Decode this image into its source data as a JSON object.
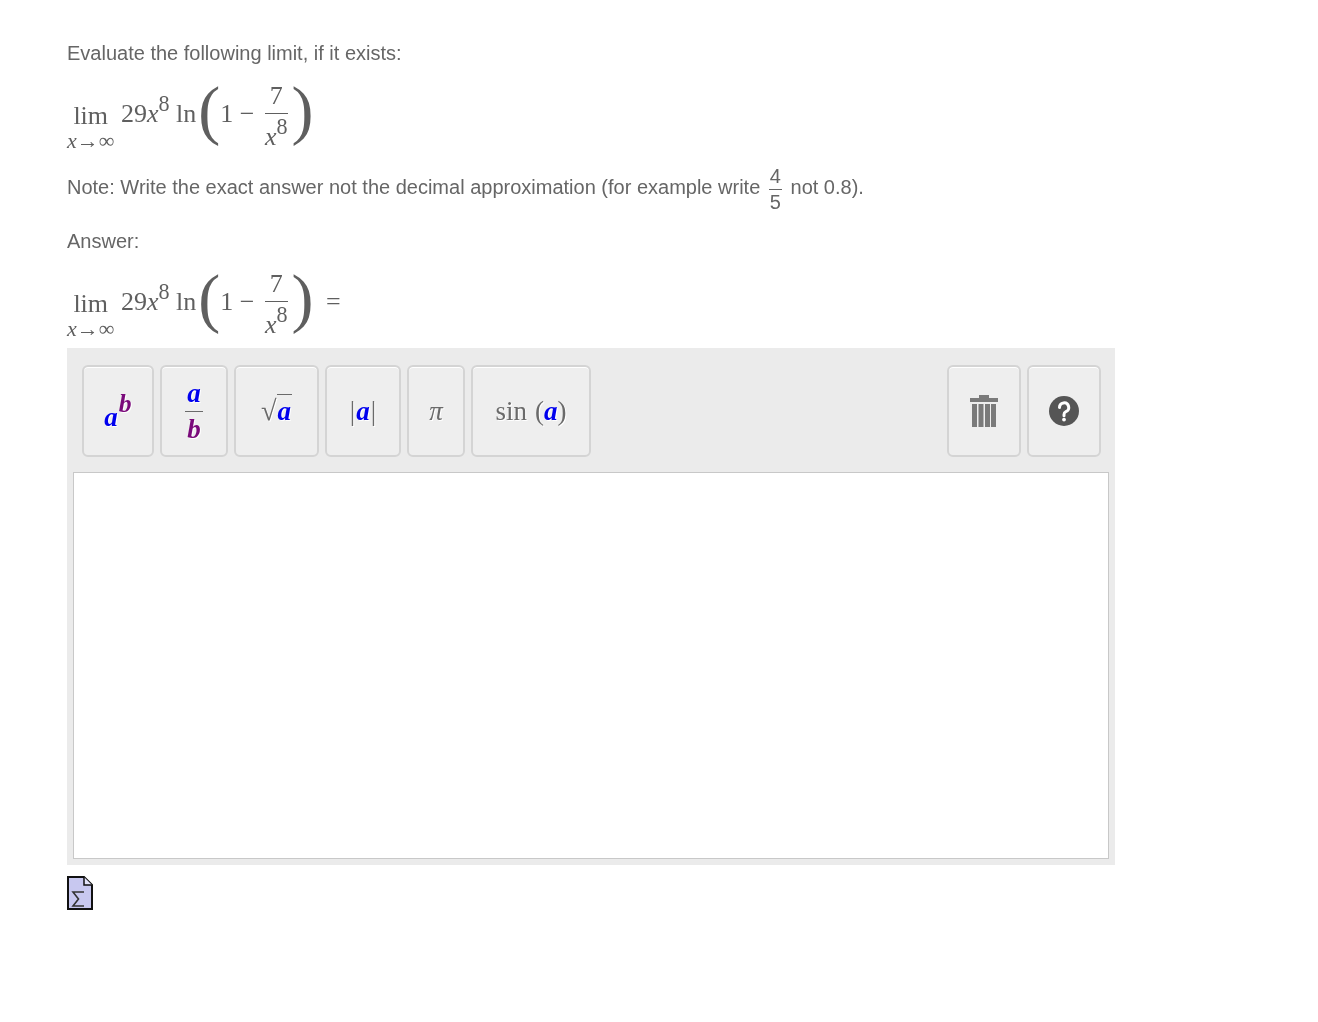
{
  "prompt": "Evaluate the following limit, if it exists:",
  "expression": {
    "operator": "lim",
    "approach_variable": "x",
    "approach_arrow": "→",
    "approach_limit": "∞",
    "coefficient": "29",
    "variable": "x",
    "power": "8",
    "function": "ln",
    "open": "(",
    "term": "1",
    "minus": "−",
    "numerator": "7",
    "denominator_variable": "x",
    "denominator_power": "8",
    "close": ")"
  },
  "note": {
    "before": "Note: Write the exact answer not the decimal approximation (for example write",
    "numerator": "4",
    "denominator": "5",
    "after": "not 0.8)."
  },
  "answer_label": "Answer:",
  "answer_expression": {
    "operator": "lim",
    "approach_variable": "x",
    "approach_arrow": "→",
    "approach_limit": "∞",
    "coefficient": "29",
    "variable": "x",
    "power": "8",
    "function": "ln",
    "open": "(",
    "term": "1",
    "minus": "−",
    "numerator": "7",
    "denominator_variable": "x",
    "denominator_power": "8",
    "close": ")",
    "equals": "="
  },
  "toolbar": {
    "buttons": [
      {
        "kind": "power",
        "base": "a",
        "exponent": "b"
      },
      {
        "kind": "fraction",
        "numerator": "a",
        "denominator": "b"
      },
      {
        "kind": "root",
        "sign": "√",
        "radicand": "a"
      },
      {
        "kind": "absolute",
        "left": "|",
        "argument": "a",
        "right": "|"
      },
      {
        "kind": "symbol",
        "symbol": "π"
      },
      {
        "kind": "function",
        "name": "sin",
        "open": "(",
        "argument": "a",
        "close": ")"
      }
    ],
    "tools": [
      {
        "kind": "clear"
      },
      {
        "kind": "help"
      }
    ]
  }
}
